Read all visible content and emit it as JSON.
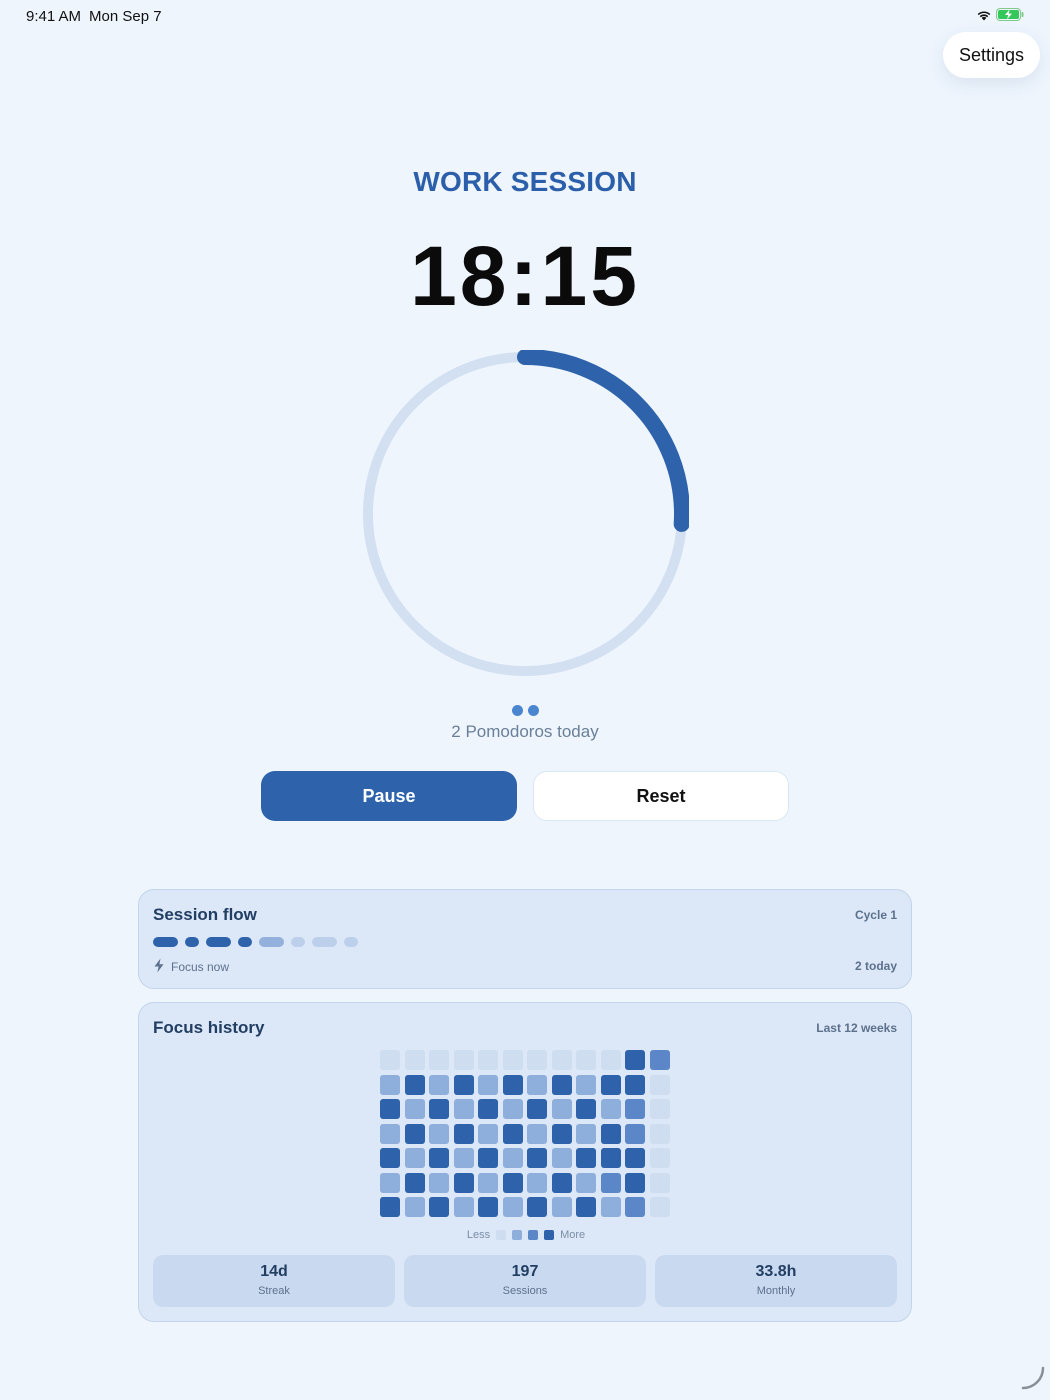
{
  "status_bar": {
    "time": "9:41 AM",
    "date": "Mon Sep 7"
  },
  "settings_label": "Settings",
  "session": {
    "title": "WORK SESSION",
    "timer": "18:15",
    "progress": 0.26,
    "pomodoros_text": "2 Pomodoros today",
    "pomodoro_count": 2
  },
  "buttons": {
    "pause": "Pause",
    "reset": "Reset"
  },
  "flow": {
    "title": "Session flow",
    "cycle": "Cycle 1",
    "status": "Focus now",
    "today": "2 today",
    "segments": [
      "focus",
      "break",
      "focus",
      "break",
      "pending-focus",
      "pending-break",
      "pending-focus",
      "pending-break"
    ]
  },
  "history": {
    "title": "Focus history",
    "range": "Last 12 weeks",
    "legend_less": "Less",
    "legend_more": "More",
    "levels": [
      [
        0,
        0,
        0,
        0,
        0,
        0,
        0,
        0,
        0,
        0,
        3,
        2
      ],
      [
        1,
        3,
        1,
        3,
        1,
        3,
        1,
        3,
        1,
        3,
        3,
        0
      ],
      [
        3,
        1,
        3,
        1,
        3,
        1,
        3,
        1,
        3,
        1,
        2,
        0
      ],
      [
        1,
        3,
        1,
        3,
        1,
        3,
        1,
        3,
        1,
        3,
        2,
        0
      ],
      [
        3,
        1,
        3,
        1,
        3,
        1,
        3,
        1,
        3,
        3,
        3,
        0
      ],
      [
        1,
        3,
        1,
        3,
        1,
        3,
        1,
        3,
        1,
        2,
        3,
        0
      ],
      [
        3,
        1,
        3,
        1,
        3,
        1,
        3,
        1,
        3,
        1,
        2,
        0
      ]
    ],
    "colors": [
      "#cfddf0",
      "#8eaedb",
      "#5b87c8",
      "#2e63ab"
    ]
  },
  "stats": [
    {
      "value": "14d",
      "label": "Streak"
    },
    {
      "value": "197",
      "label": "Sessions"
    },
    {
      "value": "33.8h",
      "label": "Monthly"
    }
  ]
}
